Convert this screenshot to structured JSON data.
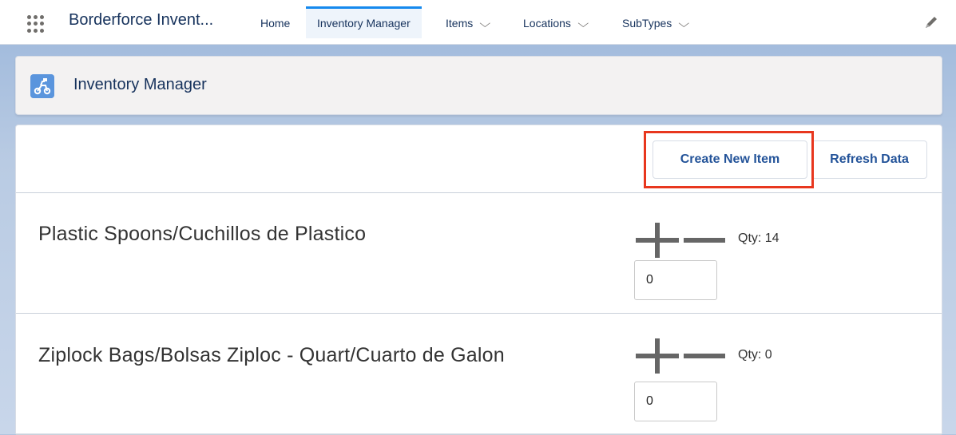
{
  "nav": {
    "app_name": "Borderforce Invent...",
    "tabs": [
      {
        "label": "Home",
        "dropdown": false
      },
      {
        "label": "Inventory Manager",
        "dropdown": false,
        "active": true
      },
      {
        "label": "Items",
        "dropdown": true
      },
      {
        "label": "Locations",
        "dropdown": true
      },
      {
        "label": "SubTypes",
        "dropdown": true
      }
    ],
    "chevron": "⌵"
  },
  "header": {
    "title": "Inventory Manager",
    "icon": "inventory-vehicle-icon"
  },
  "toolbar": {
    "create_label": "Create New Item",
    "refresh_label": "Refresh Data"
  },
  "items": [
    {
      "name": "Plastic Spoons/Cuchillos de Plastico",
      "qty_label": "Qty: 14",
      "input_value": "0"
    },
    {
      "name": "Ziplock Bags/Bolsas Ziploc - Quart/Cuarto de Galon",
      "qty_label": "Qty: 0",
      "input_value": "0"
    }
  ],
  "colors": {
    "accent": "#1589ee",
    "button_text": "#235399",
    "highlight": "#e8371e",
    "header_icon": "#5a95dd"
  }
}
